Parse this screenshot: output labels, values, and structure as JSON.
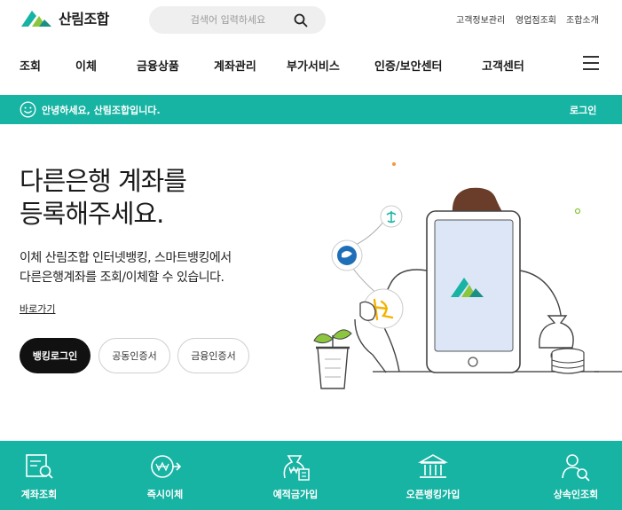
{
  "brand": {
    "name": "산림조합",
    "color": "#17b3a3"
  },
  "search": {
    "placeholder": "검색어 입력하세요",
    "icon": "search-icon"
  },
  "utility_links": [
    "고객정보관리",
    "영업점조회",
    "조합소개"
  ],
  "nav": [
    "조회",
    "이체",
    "금융상품",
    "계좌관리",
    "부가서비스",
    "인증/보안센터",
    "고객센터"
  ],
  "welcome": {
    "message": "안녕하세요, 산림조합입니다.",
    "login_label": "로그인"
  },
  "hero": {
    "title_line1": "다른은행 계좌를",
    "title_line2": "등록해주세요.",
    "desc_line1": "이체 산림조합 인터넷뱅킹, 스마트뱅킹에서",
    "desc_line2": "다른은행계좌를 조회/이체할 수 있습니다.",
    "shortcut_label": "바로가기"
  },
  "buttons": {
    "banking_login": "뱅킹로그인",
    "joint_cert": "공동인증서",
    "finance_cert": "금융인증서"
  },
  "quick_menu": [
    {
      "label": "계좌조회",
      "icon": "account-search-icon"
    },
    {
      "label": "즉시이체",
      "icon": "instant-transfer-icon"
    },
    {
      "label": "예적금가입",
      "icon": "savings-join-icon"
    },
    {
      "label": "오픈뱅킹가입",
      "icon": "open-banking-icon"
    },
    {
      "label": "상속인조회",
      "icon": "heir-search-icon"
    }
  ]
}
